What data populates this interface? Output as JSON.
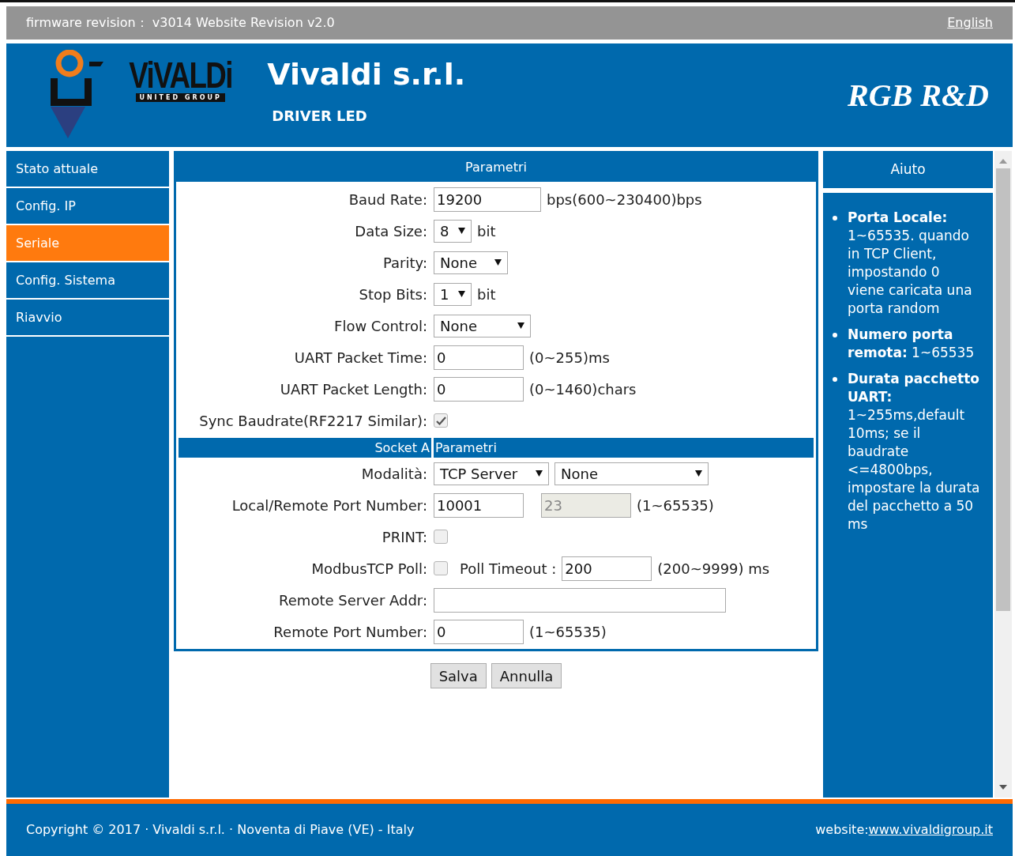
{
  "top_bar": {
    "firmware": "firmware revision： v3014 Website Revision v2.0",
    "language_link": "English"
  },
  "header": {
    "logo_word": "ViVALDi",
    "logo_tagline": "UNITED GROUP",
    "company": "Vivaldi s.r.l.",
    "product": "DRIVER LED",
    "brand": "RGB R&D"
  },
  "sidebar": {
    "items": [
      {
        "label": "Stato attuale",
        "selected": false
      },
      {
        "label": "Config. IP",
        "selected": false
      },
      {
        "label": "Seriale",
        "selected": true
      },
      {
        "label": "Config. Sistema",
        "selected": false
      },
      {
        "label": "Riavvio",
        "selected": false
      }
    ]
  },
  "parameters": {
    "title": "Parametri",
    "rows": [
      {
        "kind": "text_wide",
        "label": "Baud Rate:",
        "value": "19200",
        "hint": "bps(600~230400)bps"
      },
      {
        "kind": "select",
        "label": "Data Size:",
        "value": "8",
        "hint": "bit"
      },
      {
        "kind": "select_mid",
        "label": "Parity:",
        "value": "None"
      },
      {
        "kind": "select",
        "label": "Stop Bits:",
        "value": "1",
        "hint": "bit"
      },
      {
        "kind": "select_wide",
        "label": "Flow Control:",
        "value": "None"
      },
      {
        "kind": "text",
        "label": "UART Packet Time:",
        "value": "0",
        "hint": "(0~255)ms"
      },
      {
        "kind": "text",
        "label": "UART Packet Length:",
        "value": "0",
        "hint": "(0~1460)chars"
      },
      {
        "kind": "checkbox",
        "label": "Sync Baudrate(RF2217 Similar):",
        "checked": true
      }
    ],
    "socket_header": {
      "left": "Socket A",
      "right": "Parametri"
    },
    "socket_rows": [
      {
        "kind": "mode",
        "label": "Modalità:",
        "value": "TCP Server",
        "value_2": "None"
      },
      {
        "kind": "ports",
        "label": "Local/Remote Port Number:",
        "value": "10001",
        "value_2": "23",
        "disabled_2": true,
        "hint": "(1~65535)"
      },
      {
        "kind": "checkbox",
        "label": "PRINT:",
        "checked": false
      },
      {
        "kind": "poll",
        "label": "ModbusTCP Poll:",
        "checked": false,
        "label_2": "Poll Timeout :",
        "value": "200",
        "hint": "(200~9999) ms"
      },
      {
        "kind": "address",
        "label": "Remote Server Addr:"
      },
      {
        "kind": "text",
        "label": "Remote Port Number:",
        "value": "0",
        "hint": "(1~65535)"
      }
    ]
  },
  "buttons": [
    {
      "label": "Salva"
    },
    {
      "label": "Annulla"
    }
  ],
  "help": {
    "title": "Aiuto",
    "items": [
      "**Porta Locale:** 1~65535. quando in TCP Client, impostando 0 viene caricata una porta random",
      "**Numero porta remota:** 1~65535",
      "**Durata pacchetto UART:** 1~255ms,default 10ms; se il baudrate <=4800bps, impostare la durata del pacchetto a 50 ms"
    ]
  },
  "footer": {
    "copyright": "Copyright © 2017 · Vivaldi s.r.l. · Noventa di Piave (VE) - Italy",
    "website_label": "website:",
    "website_link": "www.vivaldigroup.it"
  }
}
